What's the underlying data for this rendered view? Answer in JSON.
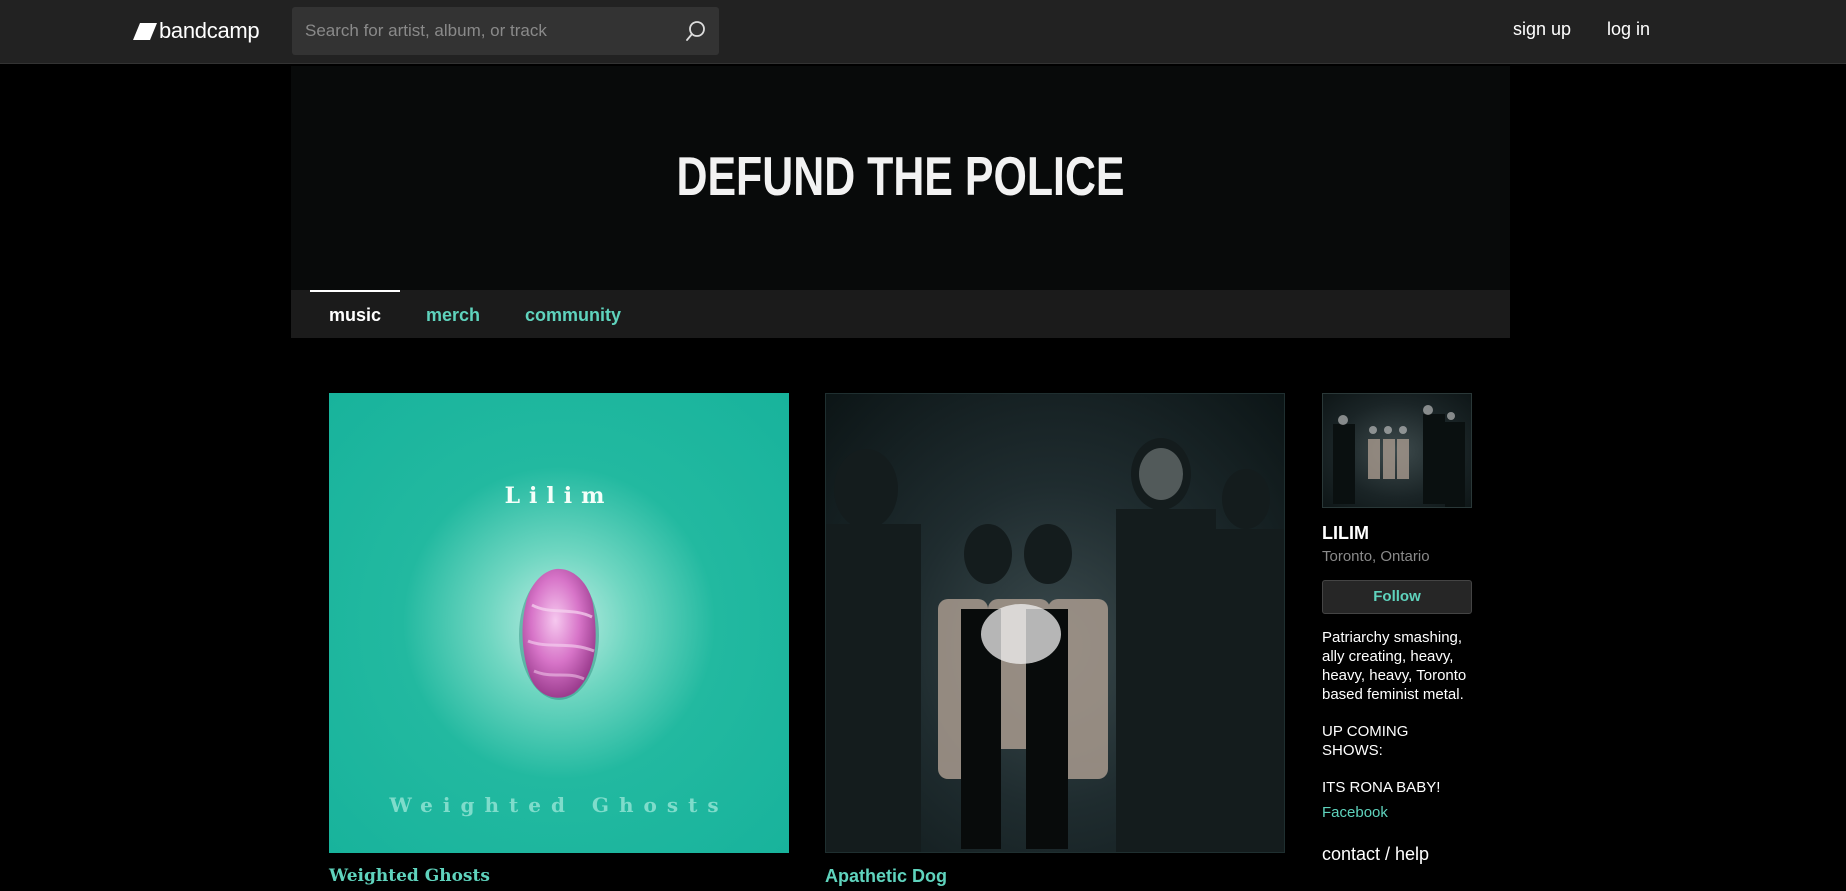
{
  "nav": {
    "brand": "bandcamp",
    "search_placeholder": "Search for artist, album, or track",
    "signup": "sign up",
    "login": "log in"
  },
  "header": {
    "title": "DEFUND THE POLICE"
  },
  "tabs": [
    {
      "label": "music",
      "active": true
    },
    {
      "label": "merch",
      "active": false
    },
    {
      "label": "community",
      "active": false
    }
  ],
  "albums": [
    {
      "title": "Weighted Ghosts",
      "cover_band": "Lilim",
      "cover_title": "Weighted Ghosts"
    },
    {
      "title": "Apathetic Dog"
    }
  ],
  "sidebar": {
    "band_name": "LILIM",
    "location": "Toronto, Ontario",
    "follow": "Follow",
    "bio": [
      "Patriarchy smashing, ally creating, heavy, heavy, heavy, Toronto based feminist metal.",
      "UP COMING SHOWS:",
      "ITS RONA BABY!"
    ],
    "facebook": "Facebook",
    "contact": "contact / help"
  },
  "colors": {
    "accent": "#5fd3bd",
    "topbar": "#222222",
    "background": "#000000"
  },
  "icons": {
    "logo": "bandcamp-parallelogram-icon",
    "search": "search-icon"
  }
}
